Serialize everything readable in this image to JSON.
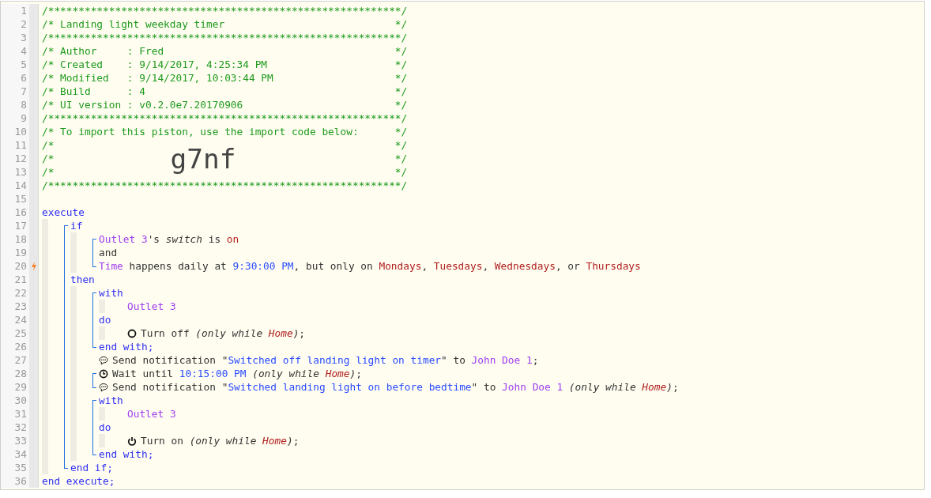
{
  "editor": {
    "lines": [
      {
        "line": "1",
        "trigger": false,
        "segments": [
          {
            "kind": "comment",
            "text": "/**********************************************************/"
          }
        ]
      },
      {
        "line": "2",
        "trigger": false,
        "segments": [
          {
            "kind": "comment",
            "text": "/* Landing light weekday timer"
          },
          {
            "kind": "comment-end",
            "text": "*/"
          }
        ]
      },
      {
        "line": "3",
        "trigger": false,
        "segments": [
          {
            "kind": "comment",
            "text": "/**********************************************************/"
          }
        ]
      },
      {
        "line": "4",
        "trigger": false,
        "segments": [
          {
            "kind": "comment",
            "text": "/* Author     : Fred"
          },
          {
            "kind": "comment-end",
            "text": "*/"
          }
        ]
      },
      {
        "line": "5",
        "trigger": false,
        "segments": [
          {
            "kind": "comment",
            "text": "/* Created    : 9/14/2017, 4:25:34 PM"
          },
          {
            "kind": "comment-end",
            "text": "*/"
          }
        ]
      },
      {
        "line": "6",
        "trigger": false,
        "segments": [
          {
            "kind": "comment",
            "text": "/* Modified   : 9/14/2017, 10:03:44 PM"
          },
          {
            "kind": "comment-end",
            "text": "*/"
          }
        ]
      },
      {
        "line": "7",
        "trigger": false,
        "segments": [
          {
            "kind": "comment",
            "text": "/* Build      : 4"
          },
          {
            "kind": "comment-end",
            "text": "*/"
          }
        ]
      },
      {
        "line": "8",
        "trigger": false,
        "segments": [
          {
            "kind": "comment",
            "text": "/* UI version : v0.2.0e7.20170906"
          },
          {
            "kind": "comment-end",
            "text": "*/"
          }
        ]
      },
      {
        "line": "9",
        "trigger": false,
        "segments": [
          {
            "kind": "comment",
            "text": "/**********************************************************/"
          }
        ]
      },
      {
        "line": "10",
        "trigger": false,
        "segments": [
          {
            "kind": "comment",
            "text": "/* To import this piston, use the import code below:"
          },
          {
            "kind": "comment-end",
            "text": "*/"
          }
        ]
      },
      {
        "line": "11",
        "trigger": false,
        "segments": [
          {
            "kind": "comment",
            "text": "/*"
          },
          {
            "kind": "comment-end",
            "text": "*/"
          }
        ]
      },
      {
        "line": "12",
        "trigger": false,
        "segments": [
          {
            "kind": "comment",
            "text": "/*"
          },
          {
            "kind": "import-code",
            "text": "g7nf"
          },
          {
            "kind": "comment-end",
            "text": "*/"
          }
        ]
      },
      {
        "line": "13",
        "trigger": false,
        "segments": [
          {
            "kind": "comment",
            "text": "/*"
          },
          {
            "kind": "comment-end",
            "text": "*/"
          }
        ]
      },
      {
        "line": "14",
        "trigger": false,
        "segments": [
          {
            "kind": "comment",
            "text": "/**********************************************************/"
          }
        ]
      },
      {
        "line": "15",
        "trigger": false
      },
      {
        "line": "16",
        "trigger": false,
        "segments": [
          {
            "kind": "keyword",
            "text": "execute"
          }
        ],
        "children": [
          {
            "bracket": [
              {
                "line": "17",
                "trigger": false,
                "segments": [
                  {
                    "kind": "keyword",
                    "text": "if"
                  }
                ],
                "children": [
                  {
                    "bracket": [
                      {
                        "line": "18",
                        "trigger": false,
                        "segments": [
                          {
                            "kind": "device",
                            "text": "Outlet 3"
                          },
                          {
                            "kind": "plain",
                            "text": "'s "
                          },
                          {
                            "kind": "italic",
                            "text": "switch"
                          },
                          {
                            "kind": "plain",
                            "text": " is "
                          },
                          {
                            "kind": "constant",
                            "text": "on"
                          }
                        ]
                      },
                      {
                        "line": "19",
                        "trigger": false,
                        "segments": [
                          {
                            "kind": "plain",
                            "text": "and"
                          }
                        ]
                      },
                      {
                        "line": "20",
                        "trigger": true,
                        "segments": [
                          {
                            "kind": "device",
                            "text": "Time"
                          },
                          {
                            "kind": "plain",
                            "text": " happens daily at "
                          },
                          {
                            "kind": "value",
                            "text": "9:30:00 PM"
                          },
                          {
                            "kind": "plain",
                            "text": ", but only on "
                          },
                          {
                            "kind": "constant",
                            "text": "Mondays"
                          },
                          {
                            "kind": "plain",
                            "text": ", "
                          },
                          {
                            "kind": "constant",
                            "text": "Tuesdays"
                          },
                          {
                            "kind": "plain",
                            "text": ", "
                          },
                          {
                            "kind": "constant",
                            "text": "Wednesdays"
                          },
                          {
                            "kind": "plain",
                            "text": ", or "
                          },
                          {
                            "kind": "constant",
                            "text": "Thursdays"
                          }
                        ]
                      }
                    ]
                  }
                ]
              },
              {
                "line": "21",
                "trigger": false,
                "segments": [
                  {
                    "kind": "keyword",
                    "text": "then"
                  }
                ],
                "children": [
                  {
                    "bracket": [
                      {
                        "line": "22",
                        "trigger": false,
                        "segments": [
                          {
                            "kind": "keyword",
                            "text": "with"
                          }
                        ],
                        "children": [
                          {
                            "line": "23",
                            "trigger": false,
                            "segments": [
                              {
                                "kind": "device",
                                "text": "Outlet 3"
                              }
                            ]
                          }
                        ]
                      },
                      {
                        "line": "24",
                        "trigger": false,
                        "segments": [
                          {
                            "kind": "keyword",
                            "text": "do"
                          }
                        ],
                        "children": [
                          {
                            "line": "25",
                            "trigger": false,
                            "kind": "switch-off",
                            "segments": [
                              {
                                "kind": "plain",
                                "text": "Turn off "
                              },
                              {
                                "kind": "italic",
                                "text": "(only while "
                              },
                              {
                                "kind": "location",
                                "text": "Home"
                              },
                              {
                                "kind": "italic",
                                "text": ")"
                              },
                              {
                                "kind": "plain",
                                "text": ";"
                              }
                            ]
                          }
                        ]
                      },
                      {
                        "line": "26",
                        "trigger": false,
                        "segments": [
                          {
                            "kind": "keyword",
                            "text": "end with;"
                          }
                        ]
                      }
                    ]
                  },
                  {
                    "line": "27",
                    "trigger": false,
                    "kind": "notify",
                    "segments": [
                      {
                        "kind": "plain",
                        "text": "Send notification \""
                      },
                      {
                        "kind": "string",
                        "text": "Switched off landing light on timer"
                      },
                      {
                        "kind": "plain",
                        "text": "\" to "
                      },
                      {
                        "kind": "device",
                        "text": "John Doe 1"
                      },
                      {
                        "kind": "plain",
                        "text": ";"
                      }
                    ]
                  },
                  {
                    "bracket": [
                      {
                        "line": "28",
                        "trigger": false,
                        "kind": "wait",
                        "segments": [
                          {
                            "kind": "plain",
                            "text": "Wait until "
                          },
                          {
                            "kind": "value",
                            "text": "10:15:00 PM"
                          },
                          {
                            "kind": "italic",
                            "text": " (only while "
                          },
                          {
                            "kind": "location",
                            "text": "Home"
                          },
                          {
                            "kind": "italic",
                            "text": ")"
                          },
                          {
                            "kind": "plain",
                            "text": ";"
                          }
                        ]
                      },
                      {
                        "line": "29",
                        "trigger": false,
                        "kind": "notify",
                        "segments": [
                          {
                            "kind": "plain",
                            "text": "Send notification \""
                          },
                          {
                            "kind": "string",
                            "text": "Switched landing light on before bedtime"
                          },
                          {
                            "kind": "plain",
                            "text": "\" to "
                          },
                          {
                            "kind": "device",
                            "text": "John Doe 1"
                          },
                          {
                            "kind": "italic",
                            "text": " (only while "
                          },
                          {
                            "kind": "location",
                            "text": "Home"
                          },
                          {
                            "kind": "italic",
                            "text": ")"
                          },
                          {
                            "kind": "plain",
                            "text": ";"
                          }
                        ]
                      }
                    ]
                  },
                  {
                    "bracket": [
                      {
                        "line": "30",
                        "trigger": false,
                        "segments": [
                          {
                            "kind": "keyword",
                            "text": "with"
                          }
                        ],
                        "children": [
                          {
                            "line": "31",
                            "trigger": false,
                            "segments": [
                              {
                                "kind": "device",
                                "text": "Outlet 3"
                              }
                            ]
                          }
                        ]
                      },
                      {
                        "line": "32",
                        "trigger": false,
                        "segments": [
                          {
                            "kind": "keyword",
                            "text": "do"
                          }
                        ],
                        "children": [
                          {
                            "line": "33",
                            "trigger": false,
                            "kind": "switch-on",
                            "segments": [
                              {
                                "kind": "plain",
                                "text": "Turn on "
                              },
                              {
                                "kind": "italic",
                                "text": "(only while "
                              },
                              {
                                "kind": "location",
                                "text": "Home"
                              },
                              {
                                "kind": "italic",
                                "text": ")"
                              },
                              {
                                "kind": "plain",
                                "text": ";"
                              }
                            ]
                          }
                        ]
                      },
                      {
                        "line": "34",
                        "trigger": false,
                        "segments": [
                          {
                            "kind": "keyword",
                            "text": "end with;"
                          }
                        ]
                      }
                    ]
                  }
                ]
              },
              {
                "line": "35",
                "trigger": false,
                "segments": [
                  {
                    "kind": "keyword",
                    "text": "end if;"
                  }
                ]
              }
            ]
          }
        ]
      },
      {
        "line": "36",
        "trigger": false,
        "segments": [
          {
            "kind": "keyword",
            "text": "end execute;"
          }
        ]
      }
    ]
  }
}
